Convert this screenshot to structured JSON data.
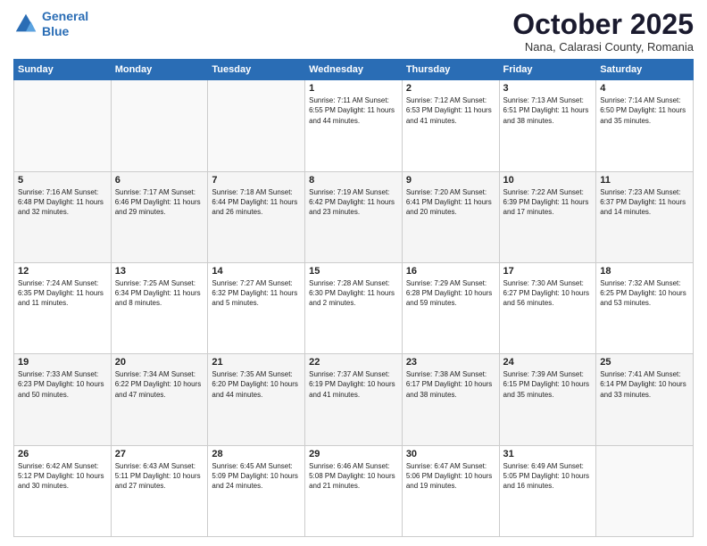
{
  "header": {
    "logo_line1": "General",
    "logo_line2": "Blue",
    "month": "October 2025",
    "location": "Nana, Calarasi County, Romania"
  },
  "days_of_week": [
    "Sunday",
    "Monday",
    "Tuesday",
    "Wednesday",
    "Thursday",
    "Friday",
    "Saturday"
  ],
  "weeks": [
    [
      {
        "day": "",
        "content": ""
      },
      {
        "day": "",
        "content": ""
      },
      {
        "day": "",
        "content": ""
      },
      {
        "day": "1",
        "content": "Sunrise: 7:11 AM\nSunset: 6:55 PM\nDaylight: 11 hours and 44 minutes."
      },
      {
        "day": "2",
        "content": "Sunrise: 7:12 AM\nSunset: 6:53 PM\nDaylight: 11 hours and 41 minutes."
      },
      {
        "day": "3",
        "content": "Sunrise: 7:13 AM\nSunset: 6:51 PM\nDaylight: 11 hours and 38 minutes."
      },
      {
        "day": "4",
        "content": "Sunrise: 7:14 AM\nSunset: 6:50 PM\nDaylight: 11 hours and 35 minutes."
      }
    ],
    [
      {
        "day": "5",
        "content": "Sunrise: 7:16 AM\nSunset: 6:48 PM\nDaylight: 11 hours and 32 minutes."
      },
      {
        "day": "6",
        "content": "Sunrise: 7:17 AM\nSunset: 6:46 PM\nDaylight: 11 hours and 29 minutes."
      },
      {
        "day": "7",
        "content": "Sunrise: 7:18 AM\nSunset: 6:44 PM\nDaylight: 11 hours and 26 minutes."
      },
      {
        "day": "8",
        "content": "Sunrise: 7:19 AM\nSunset: 6:42 PM\nDaylight: 11 hours and 23 minutes."
      },
      {
        "day": "9",
        "content": "Sunrise: 7:20 AM\nSunset: 6:41 PM\nDaylight: 11 hours and 20 minutes."
      },
      {
        "day": "10",
        "content": "Sunrise: 7:22 AM\nSunset: 6:39 PM\nDaylight: 11 hours and 17 minutes."
      },
      {
        "day": "11",
        "content": "Sunrise: 7:23 AM\nSunset: 6:37 PM\nDaylight: 11 hours and 14 minutes."
      }
    ],
    [
      {
        "day": "12",
        "content": "Sunrise: 7:24 AM\nSunset: 6:35 PM\nDaylight: 11 hours and 11 minutes."
      },
      {
        "day": "13",
        "content": "Sunrise: 7:25 AM\nSunset: 6:34 PM\nDaylight: 11 hours and 8 minutes."
      },
      {
        "day": "14",
        "content": "Sunrise: 7:27 AM\nSunset: 6:32 PM\nDaylight: 11 hours and 5 minutes."
      },
      {
        "day": "15",
        "content": "Sunrise: 7:28 AM\nSunset: 6:30 PM\nDaylight: 11 hours and 2 minutes."
      },
      {
        "day": "16",
        "content": "Sunrise: 7:29 AM\nSunset: 6:28 PM\nDaylight: 10 hours and 59 minutes."
      },
      {
        "day": "17",
        "content": "Sunrise: 7:30 AM\nSunset: 6:27 PM\nDaylight: 10 hours and 56 minutes."
      },
      {
        "day": "18",
        "content": "Sunrise: 7:32 AM\nSunset: 6:25 PM\nDaylight: 10 hours and 53 minutes."
      }
    ],
    [
      {
        "day": "19",
        "content": "Sunrise: 7:33 AM\nSunset: 6:23 PM\nDaylight: 10 hours and 50 minutes."
      },
      {
        "day": "20",
        "content": "Sunrise: 7:34 AM\nSunset: 6:22 PM\nDaylight: 10 hours and 47 minutes."
      },
      {
        "day": "21",
        "content": "Sunrise: 7:35 AM\nSunset: 6:20 PM\nDaylight: 10 hours and 44 minutes."
      },
      {
        "day": "22",
        "content": "Sunrise: 7:37 AM\nSunset: 6:19 PM\nDaylight: 10 hours and 41 minutes."
      },
      {
        "day": "23",
        "content": "Sunrise: 7:38 AM\nSunset: 6:17 PM\nDaylight: 10 hours and 38 minutes."
      },
      {
        "day": "24",
        "content": "Sunrise: 7:39 AM\nSunset: 6:15 PM\nDaylight: 10 hours and 35 minutes."
      },
      {
        "day": "25",
        "content": "Sunrise: 7:41 AM\nSunset: 6:14 PM\nDaylight: 10 hours and 33 minutes."
      }
    ],
    [
      {
        "day": "26",
        "content": "Sunrise: 6:42 AM\nSunset: 5:12 PM\nDaylight: 10 hours and 30 minutes."
      },
      {
        "day": "27",
        "content": "Sunrise: 6:43 AM\nSunset: 5:11 PM\nDaylight: 10 hours and 27 minutes."
      },
      {
        "day": "28",
        "content": "Sunrise: 6:45 AM\nSunset: 5:09 PM\nDaylight: 10 hours and 24 minutes."
      },
      {
        "day": "29",
        "content": "Sunrise: 6:46 AM\nSunset: 5:08 PM\nDaylight: 10 hours and 21 minutes."
      },
      {
        "day": "30",
        "content": "Sunrise: 6:47 AM\nSunset: 5:06 PM\nDaylight: 10 hours and 19 minutes."
      },
      {
        "day": "31",
        "content": "Sunrise: 6:49 AM\nSunset: 5:05 PM\nDaylight: 10 hours and 16 minutes."
      },
      {
        "day": "",
        "content": ""
      }
    ]
  ]
}
